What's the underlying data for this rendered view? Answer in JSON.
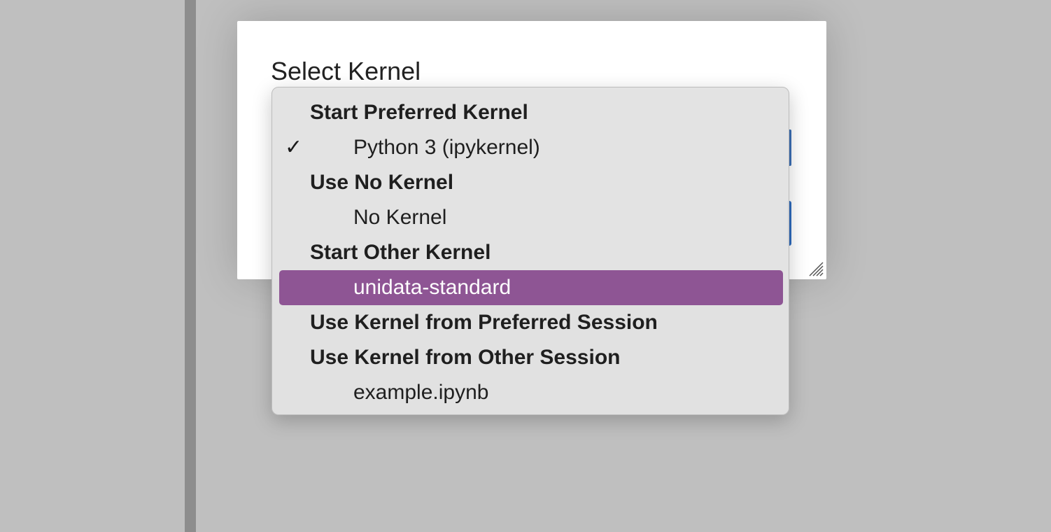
{
  "dialog": {
    "title": "Select Kernel"
  },
  "menu": {
    "groups": [
      {
        "header": "Start Preferred Kernel",
        "options": [
          {
            "label": "Python 3 (ipykernel)",
            "checked": true
          }
        ]
      },
      {
        "header": "Use No Kernel",
        "options": [
          {
            "label": "No Kernel"
          }
        ]
      },
      {
        "header": "Start Other Kernel",
        "options": [
          {
            "label": "unidata-standard",
            "highlighted": true
          }
        ]
      },
      {
        "header": "Use Kernel from Preferred Session",
        "options": []
      },
      {
        "header": "Use Kernel from Other Session",
        "options": [
          {
            "label": "example.ipynb"
          }
        ]
      }
    ],
    "check_glyph": "✓",
    "highlight_color": "#8e5594",
    "accent_color": "#2e6bbd"
  }
}
